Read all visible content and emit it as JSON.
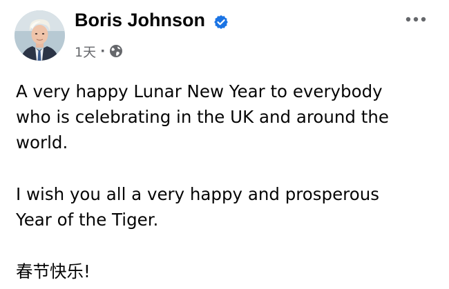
{
  "post": {
    "author": {
      "name": "Boris Johnson",
      "verified": true
    },
    "time": "1天",
    "separator": "·",
    "audience_icon": "globe-icon",
    "more_icon": "more-options-icon",
    "paragraphs": [
      [
        "A very happy Lunar New Year to everybody",
        "who is celebrating in the UK and around the",
        "world."
      ],
      [
        "I wish you all a very happy and prosperous",
        "Year of the Tiger."
      ],
      [
        "春节快乐!"
      ]
    ]
  },
  "colors": {
    "text": "#050505",
    "secondary": "#65676b",
    "verified_blue": "#1b74e4",
    "background": "#ffffff"
  }
}
